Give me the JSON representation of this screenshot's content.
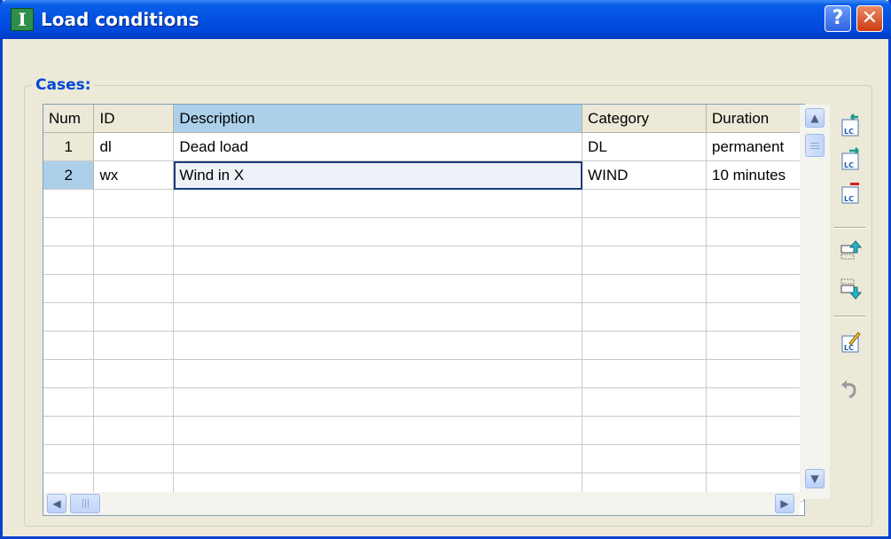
{
  "window": {
    "title": "Load conditions",
    "help_glyph": "?",
    "close_glyph": "✕"
  },
  "group": {
    "label": "Cases:"
  },
  "grid": {
    "columns": [
      "Num",
      "ID",
      "Description",
      "Category",
      "Duration"
    ],
    "active_column": "Description",
    "rows": [
      {
        "num": "1",
        "id": "dl",
        "description": "Dead load",
        "category": "DL",
        "duration": "permanent"
      },
      {
        "num": "2",
        "id": "wx",
        "description": "Wind in X",
        "category": "WIND",
        "duration": "10 minutes"
      }
    ],
    "selected_row": 2,
    "empty_rows": 11
  },
  "toolbar": {
    "buttons": [
      {
        "name": "insert-case-icon"
      },
      {
        "name": "add-case-icon"
      },
      {
        "name": "delete-case-icon"
      },
      {
        "name": "move-up-icon"
      },
      {
        "name": "move-down-icon"
      },
      {
        "name": "edit-case-icon"
      },
      {
        "name": "undo-icon"
      }
    ]
  },
  "colors": {
    "titlebar": "#0453e3",
    "selection": "#acd0ea",
    "group_label": "#0046d5"
  }
}
